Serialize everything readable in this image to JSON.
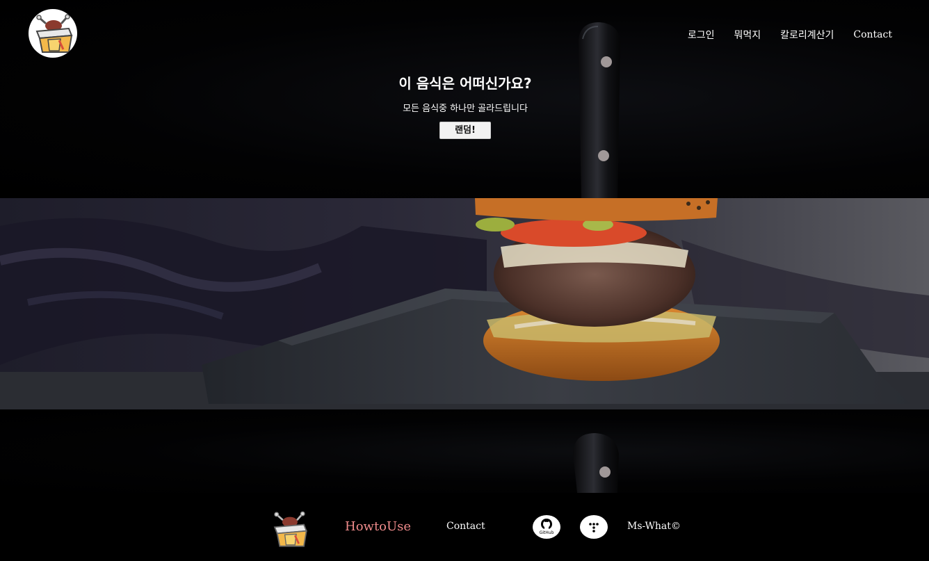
{
  "nav": {
    "items": [
      {
        "label": "로그인"
      },
      {
        "label": "뭐먹지"
      },
      {
        "label": "칼로리계산기"
      },
      {
        "label": "Contact"
      }
    ]
  },
  "hero": {
    "title": "이 음식은 어떠신가요?",
    "subtitle": "모든 음식중 하나만 골라드립니다",
    "button_label": "랜덤!"
  },
  "footer": {
    "howto_label": "HowtoUse",
    "contact_label": "Contact",
    "github_text": "GitHub",
    "copyright": "Ms-What©"
  },
  "icons": {
    "logo": "lunchbox-logo-icon",
    "github": "github-icon",
    "tistory": "tistory-icon",
    "banner": "burger-photo"
  },
  "colors": {
    "background": "#000000",
    "howto_link": "#f08c8c",
    "button_bg": "#f2f2f2"
  }
}
